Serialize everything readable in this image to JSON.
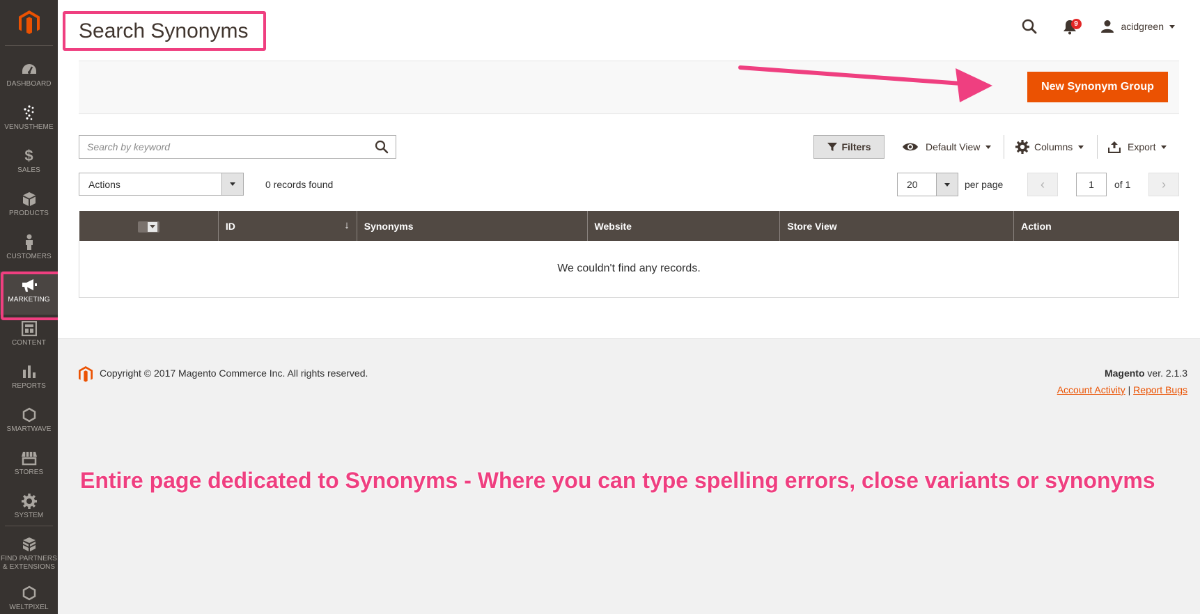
{
  "sidebar": {
    "items": [
      {
        "label": "DASHBOARD",
        "icon": "dashboard-icon"
      },
      {
        "label": "VENUSTHEME",
        "icon": "venustheme-icon"
      },
      {
        "label": "SALES",
        "icon": "dollar-icon"
      },
      {
        "label": "PRODUCTS",
        "icon": "cube-icon"
      },
      {
        "label": "CUSTOMERS",
        "icon": "person-icon"
      },
      {
        "label": "MARKETING",
        "icon": "megaphone-icon",
        "active": true
      },
      {
        "label": "CONTENT",
        "icon": "layout-icon"
      },
      {
        "label": "REPORTS",
        "icon": "bar-chart-icon"
      },
      {
        "label": "SMARTWAVE",
        "icon": "hexagon-icon"
      },
      {
        "label": "STORES",
        "icon": "storefront-icon"
      },
      {
        "label": "SYSTEM",
        "icon": "gear-icon"
      },
      {
        "label_line1": "FIND PARTNERS",
        "label_line2": "& EXTENSIONS",
        "icon": "blocks-icon"
      },
      {
        "label": "WELTPIXEL",
        "icon": "hexagon-icon"
      }
    ]
  },
  "header": {
    "title": "Search Synonyms",
    "notification_count": "9",
    "username": "acidgreen"
  },
  "action_bar": {
    "new_button_label": "New Synonym Group"
  },
  "grid": {
    "search_placeholder": "Search by keyword",
    "filters_label": "Filters",
    "view_label": "Default View",
    "columns_label": "Columns",
    "export_label": "Export",
    "actions_label": "Actions",
    "records_found": "0 records found",
    "per_page_value": "20",
    "per_page_label": "per page",
    "current_page": "1",
    "of_pages": "of 1",
    "columns": [
      "ID",
      "Synonyms",
      "Website",
      "Store View",
      "Action"
    ],
    "empty_message": "We couldn't find any records."
  },
  "footer": {
    "copyright": "Copyright © 2017 Magento Commerce Inc. All rights reserved.",
    "brand": "Magento",
    "version": " ver. 2.1.3",
    "link_activity": "Account Activity",
    "link_separator": "|",
    "link_bugs": "Report Bugs"
  },
  "annotation": {
    "text": "Entire page dedicated to Synonyms - Where you can type spelling errors, close variants or synonyms"
  },
  "colors": {
    "accent": "#eb5202",
    "annotation": "#ef3f80",
    "sidebar": "#373330",
    "table_header": "#514943"
  }
}
